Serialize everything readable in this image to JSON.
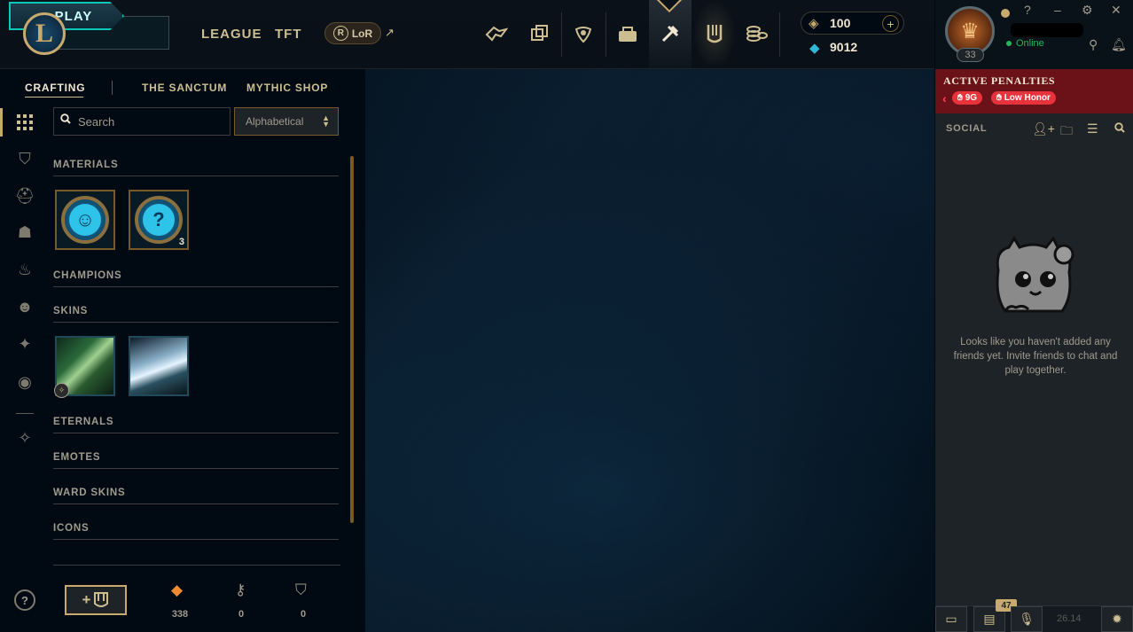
{
  "topbar": {
    "logo_letter": "L",
    "play_label": "PLAY",
    "nav": [
      "LEAGUE",
      "TFT"
    ],
    "lor_label": "LoR",
    "lor_badge": "R",
    "rp_amount": "100",
    "be_amount": "9012",
    "icons": [
      "home-icon",
      "collection-icon",
      "tft-icon",
      "profile-icon",
      "loot-icon",
      "collection-tab-icon",
      "store-icon"
    ]
  },
  "profile": {
    "level": "33",
    "status": "Online"
  },
  "subnav": {
    "crafting": "CRAFTING",
    "sanctum": "THE SANCTUM",
    "mythic_shop": "MYTHIC SHOP"
  },
  "filter": {
    "search_placeholder": "Search",
    "sort_value": "Alphabetical"
  },
  "sections": {
    "materials": "MATERIALS",
    "champions": "CHAMPIONS",
    "skins": "SKINS",
    "eternals": "ETERNALS",
    "emotes": "EMOTES",
    "ward_skins": "WARD SKINS",
    "icons": "ICONS"
  },
  "materials": [
    {
      "name": "emote-orb",
      "glyph": "☺",
      "count": ""
    },
    {
      "name": "mystery-orb",
      "glyph": "?",
      "count": "3"
    }
  ],
  "inventory": {
    "orange_essence": "338",
    "keys": "0",
    "chests": "0",
    "add_label": "+"
  },
  "social": {
    "penalties_title": "ACTIVE PENALTIES",
    "penalty_pill_1": "9G",
    "penalty_pill_2": "Low Honor",
    "title": "SOCIAL",
    "empty_message": "Looks like you haven't added any friends yet. Invite friends to chat and play together.",
    "notification_count": "47",
    "version": "26.14"
  },
  "colors": {
    "gold": "#c8aa6e",
    "teal": "#0ac8b9",
    "online": "#1fb85a",
    "penalty_red": "#e8323c",
    "essence_orange": "#f08a32"
  }
}
